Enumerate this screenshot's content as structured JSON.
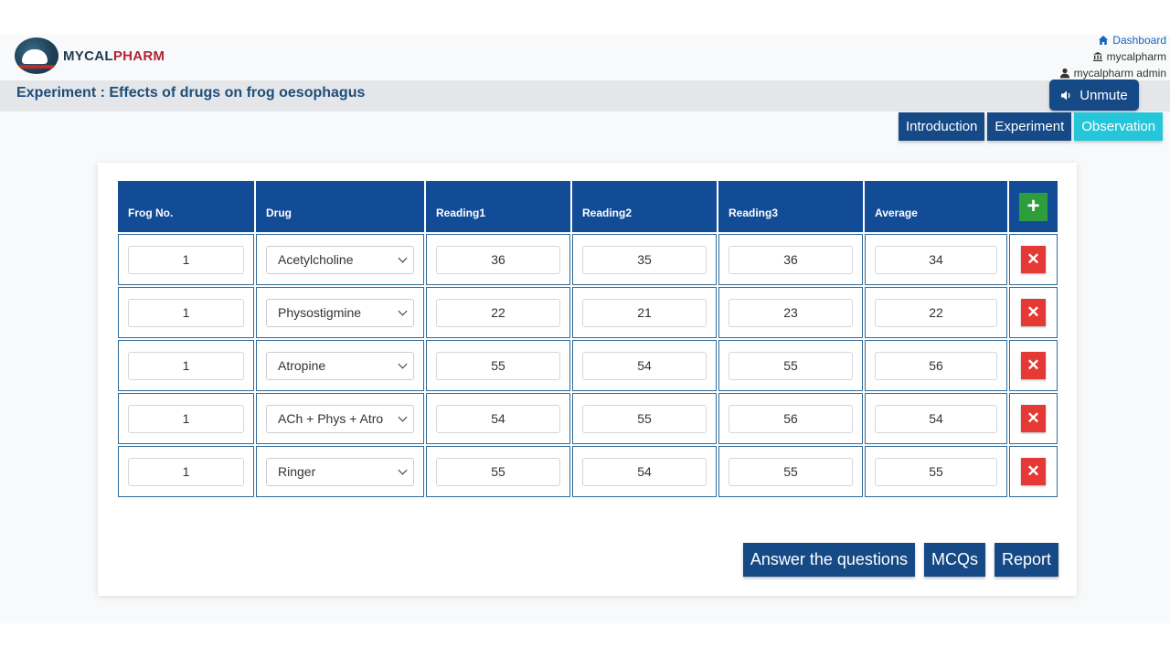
{
  "brand": {
    "name_part1": "MYCAL",
    "name_part2": "PHARM",
    "brand_color": "#1f3b52",
    "accent_color": "#b22234"
  },
  "top_links": {
    "dashboard": {
      "label": "Dashboard",
      "icon": "home-icon"
    },
    "institution": {
      "label": "mycalpharm",
      "icon": "institution-icon"
    },
    "user": {
      "label": "mycalpharm admin",
      "icon": "user-icon"
    }
  },
  "page_title": "Experiment : Effects of drugs on frog oesophagus",
  "unmute": {
    "label": "Unmute",
    "icon": "speaker-icon"
  },
  "nav_tabs": [
    {
      "label": "Introduction",
      "active": false
    },
    {
      "label": "Experiment",
      "active": false
    },
    {
      "label": "Observation",
      "active": true
    }
  ],
  "table": {
    "headers": [
      "Frog No.",
      "Drug",
      "Reading1",
      "Reading2",
      "Reading3",
      "Average"
    ],
    "add_icon": "plus-icon",
    "delete_icon": "close-icon",
    "rows": [
      {
        "frog_no": "1",
        "drug": "Acetylcholine",
        "reading1": "36",
        "reading2": "35",
        "reading3": "36",
        "average": "34"
      },
      {
        "frog_no": "1",
        "drug": "Physostigmine",
        "reading1": "22",
        "reading2": "21",
        "reading3": "23",
        "average": "22"
      },
      {
        "frog_no": "1",
        "drug": "Atropine",
        "reading1": "55",
        "reading2": "54",
        "reading3": "55",
        "average": "56"
      },
      {
        "frog_no": "1",
        "drug": "ACh + Phys + Atro",
        "reading1": "54",
        "reading2": "55",
        "reading3": "56",
        "average": "54"
      },
      {
        "frog_no": "1",
        "drug": "Ringer",
        "reading1": "55",
        "reading2": "54",
        "reading3": "55",
        "average": "55"
      }
    ]
  },
  "actions": {
    "answer": "Answer the questions",
    "mcqs": "MCQs",
    "report": "Report"
  },
  "colors": {
    "primary": "#164a86",
    "header_blue": "#124c97",
    "active_tab": "#26c6da",
    "add_green": "#2e9e3c",
    "delete_red": "#e53935"
  }
}
